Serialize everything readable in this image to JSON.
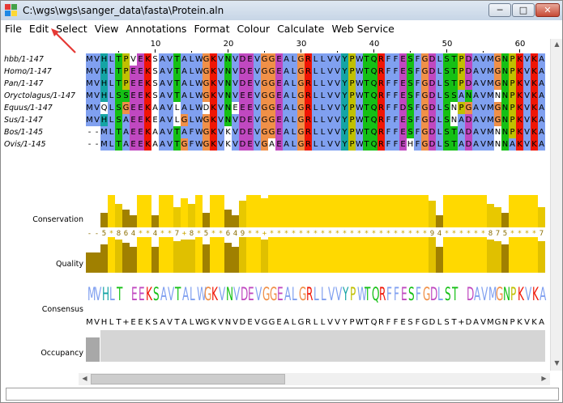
{
  "window": {
    "title": "C:\\wgs\\wgs\\sanger_data\\fasta\\Protein.aln",
    "controls": {
      "minimize": "─",
      "maximize": "□",
      "close": "✕"
    }
  },
  "menu": [
    "File",
    "Edit",
    "Select",
    "View",
    "Annotations",
    "Format",
    "Colour",
    "Calculate",
    "Web Service"
  ],
  "ruler": {
    "start": 1,
    "labels": [
      "10",
      "20",
      "30",
      "40",
      "50",
      "60"
    ]
  },
  "sequences": [
    {
      "name": "hbb/1-147",
      "seq": "MVHLTPVEKSAVTALWGKVNVDEVGGEALGRLLVVYPWTQRFFESFGDLSTPDAVMGNPKVKA"
    },
    {
      "name": "Homo/1-147",
      "seq": "MVHLTPEEKSAVTALWGKVNVDEVGGEALGRLLVVYPWTQRFFESFGDLSTPDAVMGNPKVKA"
    },
    {
      "name": "Pan/1-147",
      "seq": "MVHLTPEEKSAVTALWGKVNVDEVGGEALGRLLVVYPWTQRFFESFGDLSTPDAVMGNPKVKA"
    },
    {
      "name": "Oryctolagus/1-147",
      "seq": "MVHLSSEEKSAVTALWGKVNVEEVGGEALGRLLVVYPWTQRFFESFGDLSSANAVMNNPKVKA"
    },
    {
      "name": "Equus/1-147",
      "seq": "MVQLSGEEKAAVLALWDKVNEEEVGGEALGRLLVVYPWTQRFFDSFGDLSNPGAVMGNPKVKA"
    },
    {
      "name": "Sus/1-147",
      "seq": "MVHLSAEEKEAVLGLWGKVNVDEVGGEALGRLLVVYPWTQRFFESFGDLSNADAVMGNPKVKA"
    },
    {
      "name": "Bos/1-145",
      "seq": "--MLTAEEKAAVTAFWGKVKVDEVGGEALGRLLVVYPWTQRFFESFGDLSTADAVMNNPKVKA"
    },
    {
      "name": "Ovis/1-145",
      "seq": "--MLTAEEKAAVTGFWGKVKVDEVGAEALGRLLVVYPWTQRFFEHFGDLSTADAVMNNAKVKA"
    }
  ],
  "colours": {
    "hydrophobic": "#80a0f0",
    "negative": "#c048c0",
    "positive": "#f01505",
    "polar": "#15c015",
    "glycine": "#f09048",
    "proline": "#c0c000",
    "aromatic": "#15a4a4",
    "cysteine": "#f08080",
    "bar_yellow": "#ffd900",
    "bar_olive": "#a08000",
    "occupancy_grey": "#d5d5d5",
    "gap": "#ffffff"
  },
  "annotations": {
    "conservation_label": "Conservation",
    "quality_label": "Quality",
    "consensus_label": "Consensus",
    "occupancy_label": "Occupancy",
    "conservation_scores": "--5*864**4**7+8*5**649**+**********************94******875****7*7**",
    "consensus_seq": "MVHLT+EEKSAVTALWGKVNVDEVGGEALGRLLVVYPWTQRFFESFGDLST+DAVMGNPKVKA"
  },
  "status": ""
}
